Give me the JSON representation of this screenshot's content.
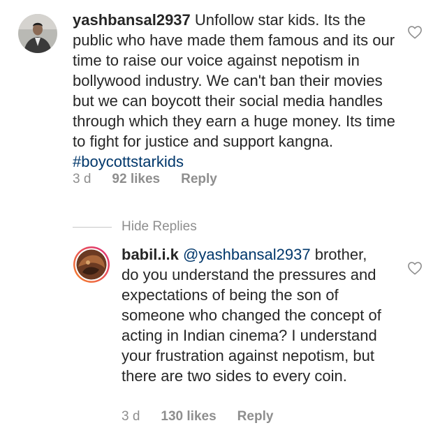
{
  "comments": [
    {
      "username": "yashbansal2937",
      "text": " Unfollow star kids. Its the public who have made them famous and its our time to raise our voice against nepotism in bollywood industry. We can't ban their movies but we can boycott their social media handles through which they earn a huge money. Its time to fight for justice and support kangna. ",
      "hashtag": "#boycottstarkids",
      "time": "3 d",
      "likes": "92 likes",
      "reply_label": "Reply",
      "avatar_icon": "profile-photo-man-suit",
      "like_icon": "heart-outline-icon"
    },
    {
      "username": "babil.i.k",
      "mention": "@yashbansal2937",
      "text": " brother, do you understand the pressures and expectations of being the son of someone who changed the concept of acting in Indian cinema? I understand your frustration against nepotism, but there are two sides to every coin.",
      "time": "3 d",
      "likes": "130 likes",
      "reply_label": "Reply",
      "avatar_icon": "profile-photo-with-story-ring",
      "like_icon": "heart-outline-icon"
    }
  ],
  "hide_replies_label": "Hide Replies",
  "colors": {
    "text": "#262626",
    "secondary": "#8e8e8e",
    "link": "#00376b",
    "story_ring_start": "#f58529",
    "story_ring_end": "#dd2a7b"
  }
}
